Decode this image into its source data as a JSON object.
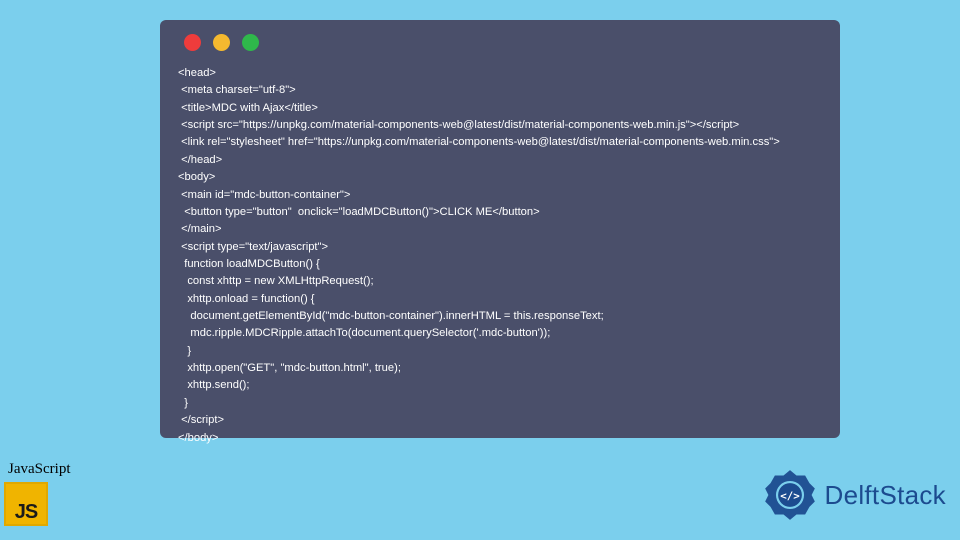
{
  "code_lines": [
    "<head>",
    " <meta charset=\"utf-8\">",
    " <title>MDC with Ajax</title>",
    " <script src=\"https://unpkg.com/material-components-web@latest/dist/material-components-web.min.js\"></script>",
    " <link rel=\"stylesheet\" href=\"https://unpkg.com/material-components-web@latest/dist/material-components-web.min.css\">",
    " </head>",
    "<body>",
    " <main id=\"mdc-button-container\">",
    "  <button type=\"button\"  onclick=\"loadMDCButton()\">CLICK ME</button>",
    " </main>",
    " <script type=\"text/javascript\">",
    "  function loadMDCButton() {",
    "   const xhttp = new XMLHttpRequest();",
    "   xhttp.onload = function() {",
    "    document.getElementById(\"mdc-button-container\").innerHTML = this.responseText;",
    "    mdc.ripple.MDCRipple.attachTo(document.querySelector('.mdc-button'));",
    "   }",
    "   xhttp.open(\"GET\", \"mdc-button.html\", true);",
    "   xhttp.send();",
    "  }",
    " </script>",
    "</body>"
  ],
  "js_label": "JavaScript",
  "js_badge": "JS",
  "brand": "DelftStack"
}
